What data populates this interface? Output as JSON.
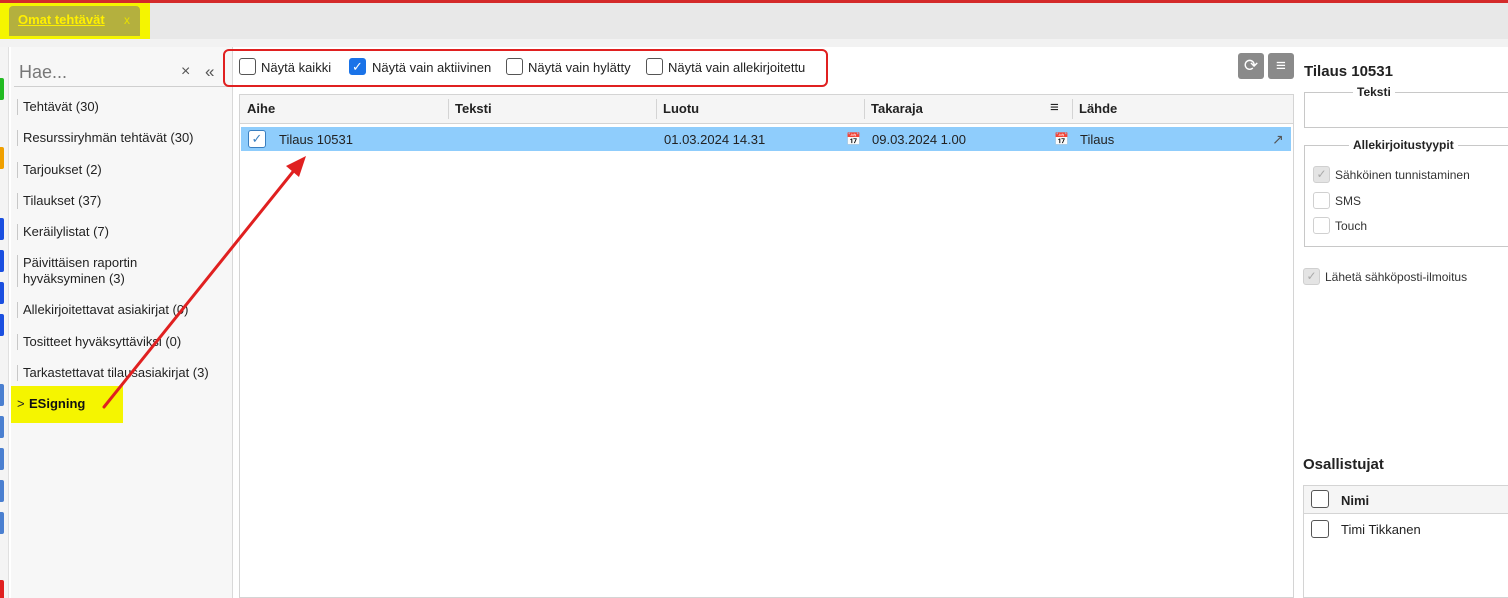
{
  "tab": {
    "label": "Omat tehtävät",
    "close": "x"
  },
  "sidebar": {
    "search_placeholder": "Hae...",
    "clear": "×",
    "collapse": "«",
    "items": [
      {
        "label": "Tehtävät (30)"
      },
      {
        "label": "Resurssiryhmän tehtävät (30)"
      },
      {
        "label": "Tarjoukset (2)"
      },
      {
        "label": "Tilaukset (37)"
      },
      {
        "label": "Keräilylistat (7)"
      },
      {
        "label": "Päivittäisen raportin hyväksyminen (3)"
      },
      {
        "label": "Allekirjoitettavat asiakirjat (0)"
      },
      {
        "label": "Tositteet hyväksyttäviksi (0)"
      },
      {
        "label": "Tarkastettavat tilausasiakirjat (3)"
      }
    ],
    "esigning": {
      "label": "ESigning",
      "chevron": ">"
    }
  },
  "filters": [
    {
      "label": "Näytä kaikki",
      "checked": false
    },
    {
      "label": "Näytä vain aktiivinen",
      "checked": true
    },
    {
      "label": "Näytä vain hylätty",
      "checked": false
    },
    {
      "label": "Näytä vain allekirjoitettu",
      "checked": false
    }
  ],
  "grid": {
    "columns": [
      "Aihe",
      "Teksti",
      "Luotu",
      "Takaraja",
      "Lähde"
    ],
    "rows": [
      {
        "aihe": "Tilaus 10531",
        "teksti": "",
        "luotu": "01.03.2024 14.31",
        "takaraja": "09.03.2024 1.00",
        "lahde": "Tilaus"
      }
    ]
  },
  "detail": {
    "title": "Tilaus 10531",
    "teksti_legend": "Teksti",
    "types_legend": "Allekirjoitustyypit",
    "types": [
      {
        "label": "Sähköinen tunnistaminen",
        "checked": true
      },
      {
        "label": "SMS",
        "checked": false
      },
      {
        "label": "Touch",
        "checked": false
      }
    ],
    "email_notify": {
      "label": "Lähetä sähköposti-ilmoitus",
      "checked": true
    },
    "participants_title": "Osallistujat",
    "participants_header": "Nimi",
    "participants": [
      {
        "name": "Timi Tikkanen"
      }
    ]
  },
  "colors": {
    "accent_red": "#e02020",
    "highlight_yellow": "#f5f500",
    "selected_row": "#8fcdfc",
    "checkbox_blue": "#1a73e8"
  }
}
